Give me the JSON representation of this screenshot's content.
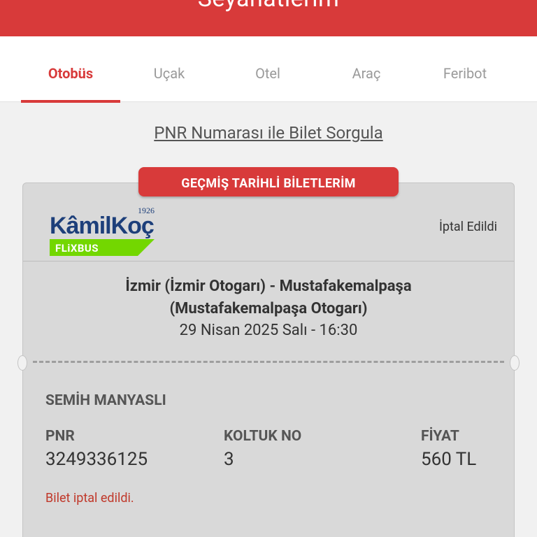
{
  "header": {
    "title": "Seyahatlerim"
  },
  "tabs": [
    {
      "label": "Otobüs"
    },
    {
      "label": "Uçak"
    },
    {
      "label": "Otel"
    },
    {
      "label": "Araç"
    },
    {
      "label": "Feribot"
    }
  ],
  "pnr_query": {
    "label": "PNR Numarası ile Bilet Sorgula"
  },
  "past_tickets_badge": "GEÇMİŞ TARİHLİ BİLETLERİM",
  "ticket": {
    "company": {
      "name": "KâmilKoç",
      "year": "1926",
      "sub": "FLiXBUS"
    },
    "status": "İptal Edildi",
    "route_line1": "İzmir (İzmir Otogarı) - Mustafakemalpaşa",
    "route_line2": "(Mustafakemalpaşa Otogarı)",
    "date": "29 Nisan 2025 Salı - 16:30",
    "passenger": "SEMİH MANYASLI",
    "pnr_label": "PNR",
    "pnr_value": "3249336125",
    "seat_label": "KOLTUK NO",
    "seat_value": "3",
    "price_label": "FİYAT",
    "price_value": "560 TL",
    "cancel_note": "Bilet iptal edildi."
  },
  "colors": {
    "accent": "#d83a3a",
    "brand_blue": "#1d3f7a",
    "brand_green": "#73d700"
  }
}
